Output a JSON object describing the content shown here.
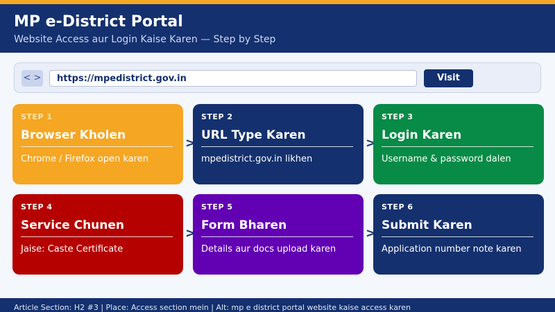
{
  "header": {
    "title": "MP e-District Portal",
    "subtitle": "Website Access aur Login Kaise Karen — Step by Step"
  },
  "browser": {
    "nav_label": "< >",
    "url": "https://mpedistrict.gov.in",
    "visit_label": "Visit"
  },
  "arrow_glyph": ">",
  "steps": [
    {
      "label": "STEP 1",
      "title": "Browser Kholen",
      "desc": "Chrome / Firefox open karen",
      "color": "#f5a623",
      "label_color": "#fde6a6"
    },
    {
      "label": "STEP 2",
      "title": "URL Type Karen",
      "desc": "mpedistrict.gov.in likhen",
      "color": "#14306e",
      "label_color": "#ffffff"
    },
    {
      "label": "STEP 3",
      "title": "Login Karen",
      "desc": "Username & password dalen",
      "color": "#078b46",
      "label_color": "#ffffff"
    },
    {
      "label": "STEP 4",
      "title": "Service Chunen",
      "desc": "Jaise: Caste Certificate",
      "color": "#b50200",
      "label_color": "#ffffff"
    },
    {
      "label": "STEP 5",
      "title": "Form Bharen",
      "desc": "Details aur docs upload karen",
      "color": "#6200b3",
      "label_color": "#ffffff"
    },
    {
      "label": "STEP 6",
      "title": "Submit Karen",
      "desc": "Application number note karen",
      "color": "#14306e",
      "label_color": "#ffffff"
    }
  ],
  "footer": {
    "text": "Article Section: H2 #3  |  Place: Access section mein  |  Alt: mp e district portal website kaise access karen"
  }
}
